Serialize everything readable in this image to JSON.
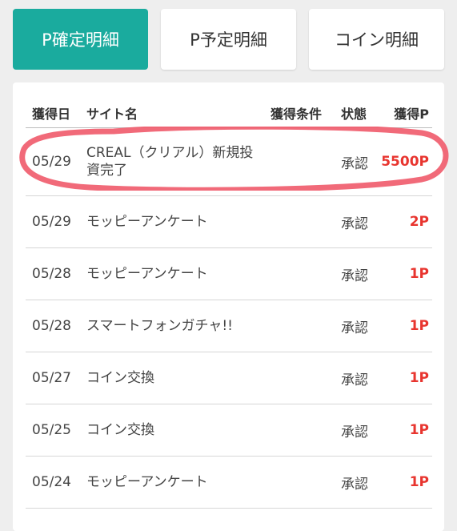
{
  "tabs": [
    {
      "label": "P確定明細",
      "active": true
    },
    {
      "label": "P予定明細",
      "active": false
    },
    {
      "label": "コイン明細",
      "active": false
    }
  ],
  "table": {
    "headers": {
      "date": "獲得日",
      "site": "サイト名",
      "condition": "獲得条件",
      "status": "状態",
      "points": "獲得P"
    },
    "rows": [
      {
        "date": "05/29",
        "site": "CREAL（クリアル）新規投資完了",
        "status": "承認",
        "points": "5500P"
      },
      {
        "date": "05/29",
        "site": "モッピーアンケート",
        "status": "承認",
        "points": "2P"
      },
      {
        "date": "05/28",
        "site": "モッピーアンケート",
        "status": "承認",
        "points": "1P"
      },
      {
        "date": "05/28",
        "site": "スマートフォンガチャ!!",
        "status": "承認",
        "points": "1P"
      },
      {
        "date": "05/27",
        "site": "コイン交換",
        "status": "承認",
        "points": "1P"
      },
      {
        "date": "05/25",
        "site": "コイン交換",
        "status": "承認",
        "points": "1P"
      },
      {
        "date": "05/24",
        "site": "モッピーアンケート",
        "status": "承認",
        "points": "1P"
      }
    ]
  },
  "colors": {
    "accent": "#1aab9e",
    "points": "#e8352f",
    "highlight_stroke": "#f05a6a"
  }
}
